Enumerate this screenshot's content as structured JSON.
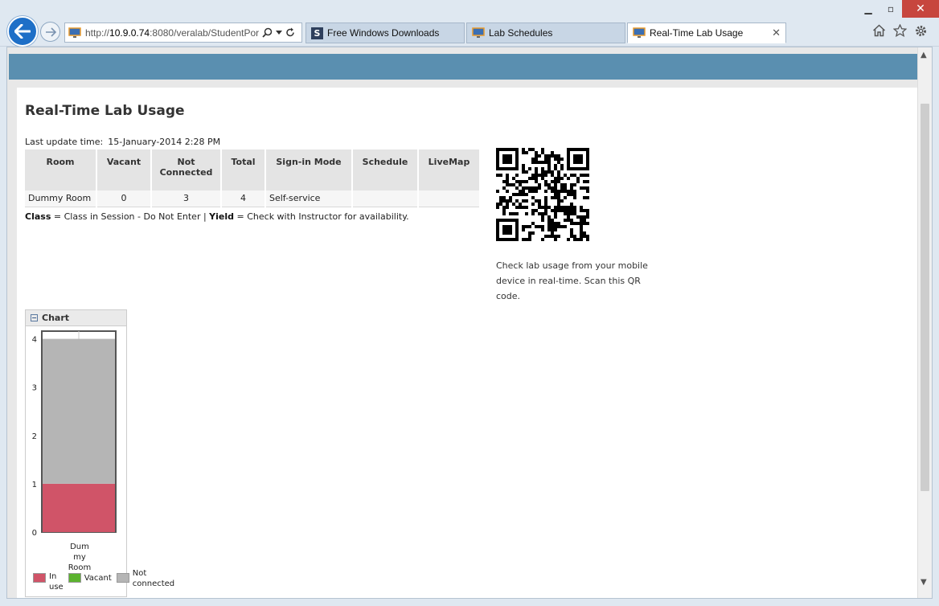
{
  "browser": {
    "url_prefix": "http://",
    "url_host": "10.9.0.74",
    "url_rest": ":8080/veralab/StudentPort",
    "tabs": [
      {
        "label": "Free Windows Downloads",
        "active": false
      },
      {
        "label": "Lab Schedules",
        "active": false
      },
      {
        "label": "Real-Time Lab Usage",
        "active": true
      }
    ]
  },
  "page": {
    "title": "Real-Time Lab Usage",
    "last_update_label": "Last update time:",
    "last_update_value": "15-January-2014 2:28 PM"
  },
  "table": {
    "headers": [
      "Room",
      "Vacant",
      "Not Connected",
      "Total",
      "Sign-in Mode",
      "Schedule",
      "LiveMap"
    ],
    "rows": [
      {
        "room": "Dummy Room",
        "vacant": "0",
        "not_connected": "3",
        "total": "4",
        "sign_in_mode": "Self-service",
        "schedule": "",
        "livemap": ""
      }
    ]
  },
  "legend_line": {
    "class_term": "Class",
    "class_desc": " = Class in Session - Do Not Enter | ",
    "yield_term": "Yield",
    "yield_desc": " = Check with Instructor for availability."
  },
  "qr": {
    "text": "Check lab usage from your mobile device in real-time. Scan this QR code."
  },
  "chart_panel": {
    "title": "Chart",
    "toggle": "−"
  },
  "chart_data": {
    "type": "bar",
    "stacked": true,
    "categories": [
      "Dummy Room"
    ],
    "category_label_lines": [
      "Dum",
      "my",
      "Room"
    ],
    "series": [
      {
        "name": "In use",
        "values": [
          1
        ],
        "color": "#d05468"
      },
      {
        "name": "Vacant",
        "values": [
          0
        ],
        "color": "#5cb32f"
      },
      {
        "name": "Not connected",
        "values": [
          3
        ],
        "color": "#b5b5b5"
      }
    ],
    "legend_labels": [
      {
        "line1": "In",
        "line2": "use"
      },
      {
        "line1": "Vacant",
        "line2": ""
      },
      {
        "line1": "Not",
        "line2": "connected"
      }
    ],
    "ylim": [
      0,
      4
    ],
    "yticks": [
      0,
      1,
      2,
      3,
      4
    ],
    "legend": "bottom"
  }
}
